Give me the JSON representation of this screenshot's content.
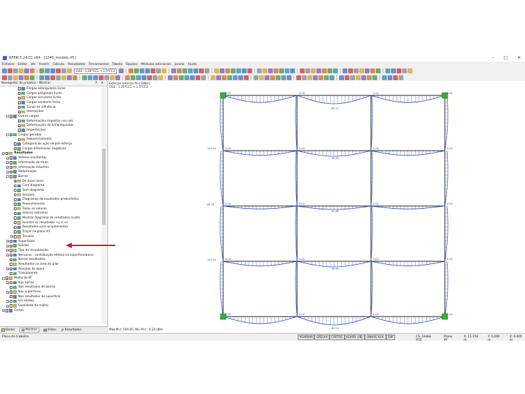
{
  "window": {
    "title": "RFEM 5.24.01 x64 - [1045_modelo.rf5]",
    "controls": [
      "–",
      "□",
      "✕"
    ]
  },
  "menu": [
    "Ficheiro",
    "Editar",
    "Ver",
    "Inserir",
    "Cálculo",
    "Resultados",
    "Ferramentas",
    "Tabela",
    "Opções",
    "Módulos adicionais",
    "Janela",
    "Ajuda"
  ],
  "toolbar": {
    "load_combo": "CO2 - 1.35*CC1 + 1.5*CC2"
  },
  "navigator": {
    "title": "Navegador de projetos - Mostrar",
    "items": [
      {
        "text": "Cargas retangulares livres",
        "level": 4,
        "check": "on",
        "exp": ""
      },
      {
        "text": "Cargas poligonais livres",
        "level": 4,
        "check": "on",
        "exp": ""
      },
      {
        "text": "Cargas circulares livres",
        "level": 4,
        "check": "on",
        "exp": ""
      },
      {
        "text": "Cargas variáveis livres",
        "level": 4,
        "check": "on",
        "exp": ""
      },
      {
        "text": "Zonas de influência",
        "level": 4,
        "check": "on",
        "exp": ""
      },
      {
        "text": "Interseções",
        "level": 4,
        "check": "on",
        "exp": ""
      },
      {
        "text": "Outras cargas",
        "level": 2,
        "check": "on",
        "exp": "-"
      },
      {
        "text": "Deformações impostas nos nós",
        "level": 4,
        "check": "on",
        "exp": ""
      },
      {
        "text": "Deformações de linha impostas",
        "level": 4,
        "check": "on",
        "exp": ""
      },
      {
        "text": "Imperfeições",
        "level": 4,
        "check": "on",
        "exp": ""
      },
      {
        "text": "Cargas geradas",
        "level": 2,
        "check": "on",
        "exp": "-"
      },
      {
        "text": "Sequenciamento",
        "level": 4,
        "check": "off",
        "exp": ""
      },
      {
        "text": "Categoria de ação de pré-esforço",
        "level": 3,
        "check": "on",
        "exp": ""
      },
      {
        "text": "Cargas diferenciais negativas",
        "level": 3,
        "check": "on",
        "exp": ""
      },
      {
        "text": "Resultados",
        "level": 1,
        "check": "on",
        "exp": "-",
        "bold": true
      },
      {
        "text": "Valores resultantes",
        "level": 2,
        "check": "on",
        "exp": "+"
      },
      {
        "text": "Informação do título",
        "level": 2,
        "check": "on",
        "exp": "+"
      },
      {
        "text": "Informação máx/mín",
        "level": 2,
        "check": "on",
        "exp": "+"
      },
      {
        "text": "Deformação",
        "level": 2,
        "check": "on",
        "exp": "+"
      },
      {
        "text": "Barras",
        "level": 2,
        "check": "on",
        "exp": "-"
      },
      {
        "text": "De duas cores",
        "level": 3,
        "radio": "on"
      },
      {
        "text": "Com diagrama",
        "level": 3,
        "radio": "off"
      },
      {
        "text": "Sem diagrama",
        "level": 3,
        "radio": "off"
      },
      {
        "text": "Secções",
        "level": 3,
        "radio": "off"
      },
      {
        "text": "Diagramas de resultados preenchidos",
        "level": 3,
        "check": "off"
      },
      {
        "text": "Preenchimento",
        "level": 3,
        "check": "on"
      },
      {
        "text": "Todos os valores",
        "level": 3,
        "check": "off"
      },
      {
        "text": "Valores extremos",
        "level": 3,
        "check": "off"
      },
      {
        "text": "Mostrar diagrama de resultados oculto",
        "level": 3,
        "check": "off"
      },
      {
        "text": "Inverter os resultados +y e +z",
        "level": 3,
        "check": "off"
      },
      {
        "text": "Resultados para acoplamentos",
        "level": 3,
        "check": "off"
      },
      {
        "text": "Traçar no plano XY",
        "level": 3,
        "check": "on"
      },
      {
        "text": "Tensões",
        "level": 3,
        "check": "off",
        "exp": "+"
      },
      {
        "text": "Superfícies",
        "level": 2,
        "check": "on",
        "exp": "+"
      },
      {
        "text": "Sólidos",
        "level": 2,
        "check": "on",
        "exp": "+"
      },
      {
        "text": "Tipo de visualização",
        "level": 2,
        "check": "on",
        "exp": "+"
      },
      {
        "text": "Nervuras - contribuição efetiva na superfície/barra",
        "level": 2,
        "check": "on",
        "exp": "+"
      },
      {
        "text": "Barras resultantes",
        "level": 2,
        "check": "on",
        "exp": ""
      },
      {
        "text": "Resultados na área do pilar",
        "level": 2,
        "check": "off",
        "exp": ""
      },
      {
        "text": "Reações de apoio",
        "level": 2,
        "check": "on",
        "exp": "+"
      },
      {
        "text": "Transparente",
        "level": 2,
        "check": "off",
        "exp": ""
      },
      {
        "text": "Malha de EF",
        "level": 1,
        "check": "on",
        "exp": "-"
      },
      {
        "text": "Nas barras",
        "level": 2,
        "check": "off",
        "exp": "+"
      },
      {
        "text": "Nos resultados de barras",
        "level": 2,
        "check": "off",
        "exp": ""
      },
      {
        "text": "Nas superfícies",
        "level": 2,
        "check": "on",
        "exp": "+"
      },
      {
        "text": "Nos resultados de superfície",
        "level": 2,
        "check": "off",
        "exp": ""
      },
      {
        "text": "Em sólidos",
        "level": 2,
        "check": "off",
        "exp": "+"
      },
      {
        "text": "Qualidade da malha",
        "level": 2,
        "check": "off",
        "exp": "+"
      },
      {
        "text": "Cortes",
        "level": 1,
        "check": "on",
        "exp": "+"
      }
    ],
    "tabs": [
      "Dados",
      "Mostrar",
      "Vistas",
      "Resultados"
    ]
  },
  "view": {
    "title": "Esforços internos M-z [kNm]",
    "subtitle": "CO2 : 1.35*CC1 + 1.5*CC2",
    "footer": "Máx M-z: 104.05, Mín M-z: -0.24 kNm",
    "labels": {
      "top_mid": "82.11",
      "bot_mid": "82.11",
      "row2_left": "142.04",
      "row3_left": "84.20",
      "row4_left": "142.04",
      "row2_mid": "58.56",
      "row3_mid": "52.36",
      "row4_mid": "58.56",
      "node_val": "0.00"
    }
  },
  "status": {
    "left": "Plano de trabalho",
    "buttons": [
      "AGARRAR",
      "GRELHA",
      "CARTOG",
      "AGARR. OBJ.",
      "LINHAS AUX.",
      "DXF"
    ],
    "cs": "CS: Global XYZ",
    "plane": "Plano: XY",
    "x": "X: 15.150 m",
    "y": "Y: 0.000 m",
    "z": "Z: 0.000 m"
  },
  "colors": {
    "diagram": "#1e40c8",
    "support": "#2fb82f",
    "arrow": "#cc1f1f"
  }
}
